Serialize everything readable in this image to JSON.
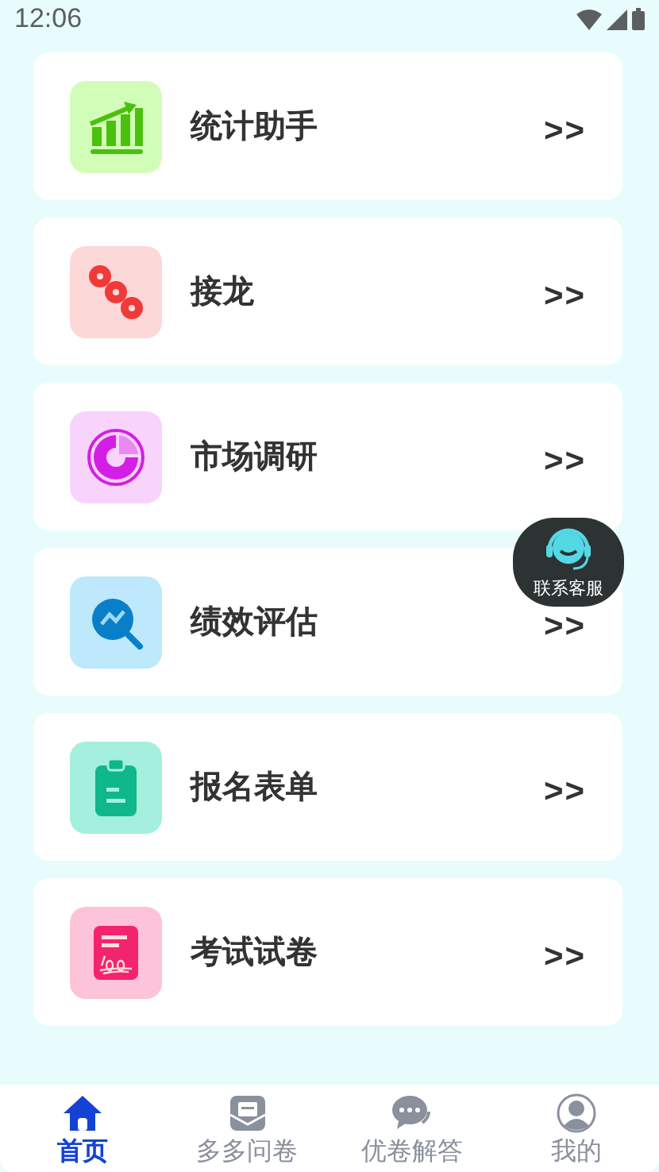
{
  "status_bar": {
    "time": "12:06"
  },
  "items": [
    {
      "kind": "chart",
      "title": "统计助手",
      "arrow": ">>"
    },
    {
      "kind": "chain",
      "title": "接龙",
      "arrow": ">>"
    },
    {
      "kind": "donut",
      "title": "市场调研",
      "arrow": ">>"
    },
    {
      "kind": "search",
      "title": "绩效评估",
      "arrow": ">>"
    },
    {
      "kind": "clipboard",
      "title": "报名表单",
      "arrow": ">>"
    },
    {
      "kind": "exam",
      "title": "考试试卷",
      "arrow": ">>"
    }
  ],
  "float_button": {
    "label": "联系客服"
  },
  "nav": [
    {
      "kind": "home",
      "label": "首页",
      "selected": true
    },
    {
      "kind": "mail",
      "label": "多多问卷",
      "selected": false
    },
    {
      "kind": "chat",
      "label": "优卷解答",
      "selected": false
    },
    {
      "kind": "user",
      "label": "我的",
      "selected": false
    }
  ]
}
